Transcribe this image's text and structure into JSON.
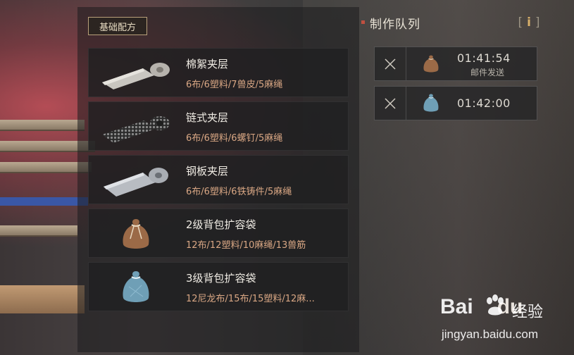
{
  "recipes": {
    "tab_label": "基础配方",
    "items": [
      {
        "name": "棉絮夹层",
        "cost": "6布/6塑料/7兽皮/5麻绳",
        "icon": "cotton-layer-icon"
      },
      {
        "name": "链式夹层",
        "cost": "6布/6塑料/6螺钉/5麻绳",
        "icon": "chain-layer-icon"
      },
      {
        "name": "钢板夹层",
        "cost": "6布/6塑料/6铁铸件/5麻绳",
        "icon": "steel-plate-layer-icon"
      },
      {
        "name": "2级背包扩容袋",
        "cost": "12布/12塑料/10麻绳/13兽筋",
        "icon": "brown-pouch-icon"
      },
      {
        "name": "3级背包扩容袋",
        "cost": "12尼龙布/15布/15塑料/12麻...",
        "icon": "blue-pouch-icon"
      }
    ]
  },
  "queue": {
    "title": "制作队列",
    "info_label": "i",
    "items": [
      {
        "time": "01:41:54",
        "status": "邮件发送",
        "icon": "brown-pouch-icon"
      },
      {
        "time": "01:42:00",
        "status": "",
        "icon": "blue-pouch-icon"
      }
    ]
  },
  "watermark": {
    "logo_a": "Bai",
    "logo_b": "du",
    "cn": "经验",
    "url": "jingyan.baidu.com"
  },
  "colors": {
    "cost_text": "#d9a784",
    "accent_gold": "#d8b06a",
    "queue_dot": "#c05040"
  }
}
